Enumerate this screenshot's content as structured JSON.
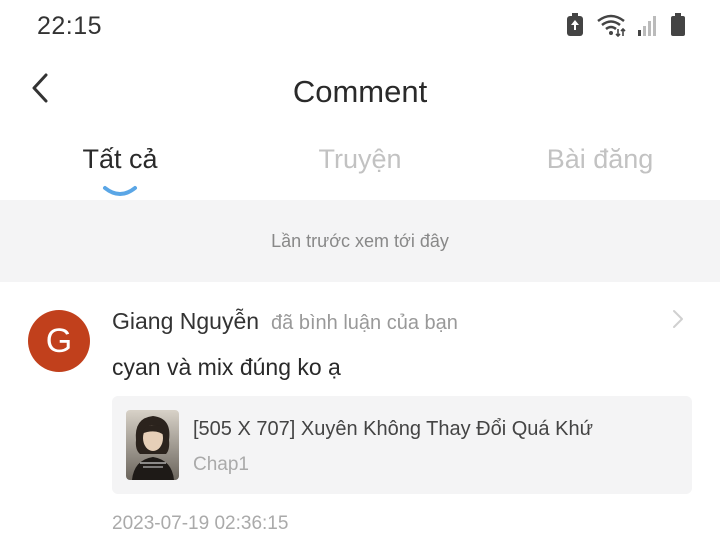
{
  "status_bar": {
    "time": "22:15"
  },
  "header": {
    "title": "Comment"
  },
  "tabs": [
    {
      "label": "Tất cả",
      "active": true
    },
    {
      "label": "Truyện",
      "active": false
    },
    {
      "label": "Bài đăng",
      "active": false
    }
  ],
  "divider": {
    "text": "Lần trước xem tới đây"
  },
  "comment": {
    "avatar_letter": "G",
    "avatar_color": "#c1401c",
    "user_name": "Giang Nguyễn",
    "action": "đã bình luận của bạn",
    "text": "cyan và mix đúng ko ạ",
    "story": {
      "title": "[505 X 707] Xuyên Không Thay Đổi Quá Khứ",
      "chapter": "Chap1"
    },
    "timestamp": "2023-07-19 02:36:15"
  },
  "colors": {
    "accent": "#5aa6e6",
    "band_bg": "#f4f4f5"
  }
}
